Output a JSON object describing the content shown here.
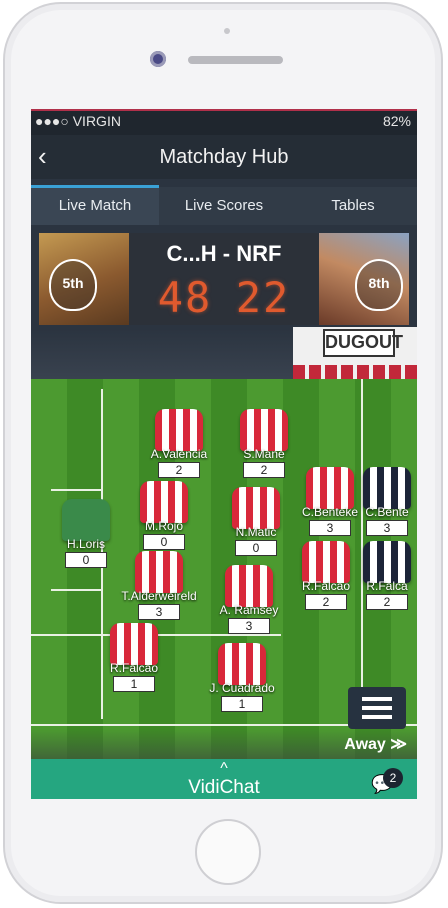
{
  "status_bar": {
    "carrier": "●●●○ VIRGIN",
    "wifi_icon": "wifi-icon",
    "battery": "82%"
  },
  "header": {
    "title": "Matchday Hub",
    "back_icon": "chevron-left-icon"
  },
  "tabs": [
    {
      "label": "Live Match",
      "active": true
    },
    {
      "label": "Live Scores",
      "active": false
    },
    {
      "label": "Tables",
      "active": false
    }
  ],
  "scoreboard": {
    "teams": "C...H - NRF",
    "home_rank": "5th",
    "away_rank": "8th",
    "home_score": "48",
    "away_score": "22"
  },
  "sponsor": "DUGOUT",
  "players": [
    {
      "name": "A.Valencia",
      "score": "2"
    },
    {
      "name": "S.Mane",
      "score": "2"
    },
    {
      "name": "M.Rojo",
      "score": "0"
    },
    {
      "name": "N.Matic",
      "score": "0"
    },
    {
      "name": "C.Benteke",
      "score": "3"
    },
    {
      "name": "C.Bente",
      "score": "3"
    },
    {
      "name": "H.Loris",
      "score": "0"
    },
    {
      "name": "T.Alderweireld",
      "score": "3"
    },
    {
      "name": "A. Ramsey",
      "score": "3"
    },
    {
      "name": "R.Falcao",
      "score": "2"
    },
    {
      "name": "R.Falca",
      "score": "2"
    },
    {
      "name": "R.Falcao",
      "score": "1"
    },
    {
      "name": "J. Cuadrado",
      "score": "1"
    }
  ],
  "away_label": "Away ≫",
  "vidichat": {
    "caret": "^",
    "label": "VidiChat",
    "badge": "2"
  },
  "colors": {
    "accent": "#25a680",
    "tab_indicator": "#3aa1d6",
    "score_led": "#e05a2e"
  }
}
